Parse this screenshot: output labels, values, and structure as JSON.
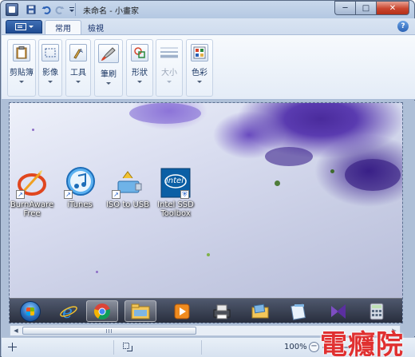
{
  "window": {
    "title": "未命名 - 小畫家",
    "app_icon": "paint-app-icon",
    "quick_access": [
      "save-icon",
      "undo-icon",
      "redo-icon",
      "qat-dropdown-icon"
    ],
    "controls": {
      "minimize": "─",
      "maximize": "□",
      "close": "✕"
    }
  },
  "ribbon": {
    "app_menu_icon": "paint-menu-icon",
    "tabs": [
      {
        "label": "常用",
        "active": true
      },
      {
        "label": "檢視",
        "active": false
      }
    ],
    "help_glyph": "?",
    "groups": [
      {
        "label": "剪貼簿",
        "icon": "clipboard-icon",
        "enabled": true
      },
      {
        "label": "影像",
        "icon": "image-select-icon",
        "enabled": true
      },
      {
        "label": "工具",
        "icon": "tools-icon",
        "enabled": true
      },
      {
        "label": "筆刷",
        "icon": "brush-icon",
        "enabled": true
      },
      {
        "label": "形狀",
        "icon": "shapes-icon",
        "enabled": true
      },
      {
        "label": "大小",
        "icon": "size-icon",
        "enabled": false
      },
      {
        "label": "色彩",
        "icon": "colors-icon",
        "enabled": true
      }
    ]
  },
  "desktop": {
    "icons": [
      {
        "label_line1": "BurnAware",
        "label_line2": "Free",
        "icon": "burnaware-icon"
      },
      {
        "label_line1": "iTunes",
        "label_line2": "",
        "icon": "itunes-icon"
      },
      {
        "label_line1": "ISO to USB",
        "label_line2": "",
        "icon": "iso-to-usb-icon"
      },
      {
        "label_line1": "Intel SSD",
        "label_line2": "Toolbox",
        "icon": "intel-ssd-icon"
      }
    ],
    "taskbar": [
      "start-orb-icon",
      "internet-explorer-icon",
      "chrome-icon",
      "file-explorer-icon",
      "media-player-icon",
      "printer-icon",
      "folder-icon",
      "notes-icon",
      "visual-studio-icon",
      "calculator-icon"
    ],
    "intel_logo_text": "intel"
  },
  "statusbar": {
    "zoom": "100%",
    "zoom_minus": "−"
  },
  "watermark": "電癮院"
}
